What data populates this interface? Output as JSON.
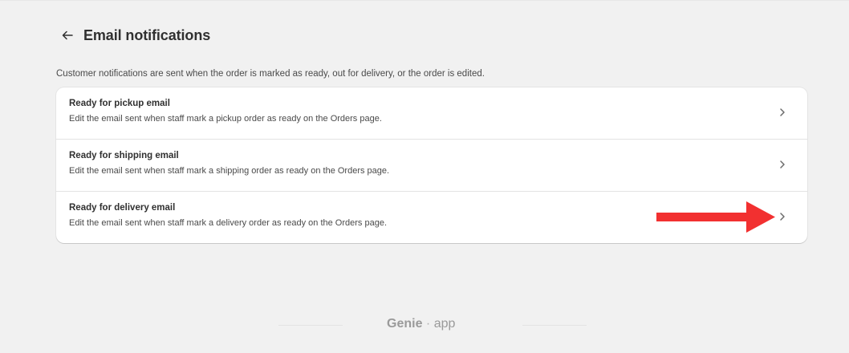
{
  "header": {
    "title": "Email notifications",
    "back_icon": "arrow-left-icon"
  },
  "description": "Customer notifications are sent when the order is marked as ready, out for delivery, or the order is edited.",
  "notifications": [
    {
      "title": "Ready for pickup email",
      "description": "Edit the email sent when staff mark a pickup order as ready on the Orders page."
    },
    {
      "title": "Ready for shipping email",
      "description": "Edit the email sent when staff mark a shipping order as ready on the Orders page."
    },
    {
      "title": "Ready for delivery email",
      "description": "Edit the email sent when staff mark a delivery order as ready on the Orders page."
    }
  ],
  "annotation": {
    "icon": "red-arrow-icon",
    "color": "#f23030"
  },
  "footer": {
    "brand_name": "Genie",
    "brand_separator": "·",
    "brand_suffix": "app"
  },
  "colors": {
    "background": "#f1f1f1",
    "card": "#ffffff",
    "text": "#303030",
    "muted": "#9a9a9a"
  }
}
